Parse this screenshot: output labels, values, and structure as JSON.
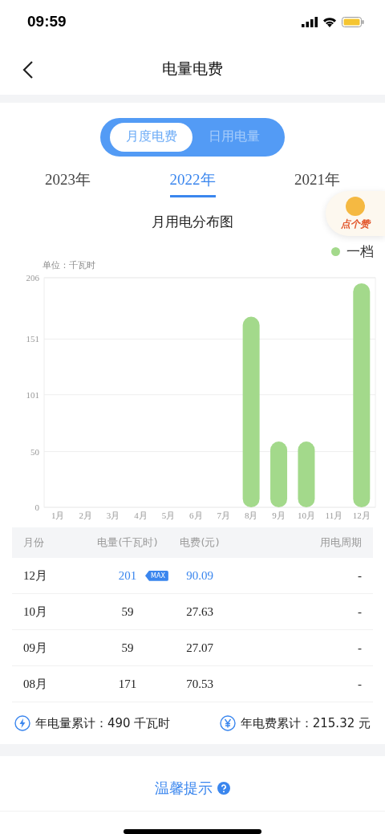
{
  "status_bar": {
    "time": "09:59"
  },
  "nav": {
    "title": "电量电费"
  },
  "mode_tabs": [
    {
      "label": "月度电费",
      "selected": true
    },
    {
      "label": "日用电量",
      "selected": false
    }
  ],
  "years": [
    {
      "label": "2023年",
      "selected": false
    },
    {
      "label": "2022年",
      "selected": true
    },
    {
      "label": "2021年",
      "selected": false
    }
  ],
  "like_badge": {
    "label": "点个赞"
  },
  "chart": {
    "title": "月用电分布图",
    "unit": "单位：千瓦时",
    "chart_data": {
      "type": "bar",
      "categories": [
        "1月",
        "2月",
        "3月",
        "4月",
        "5月",
        "6月",
        "7月",
        "8月",
        "9月",
        "10月",
        "11月",
        "12月"
      ],
      "series": [
        {
          "name": "一档",
          "color": "#a3d98b",
          "values": [
            null,
            null,
            null,
            null,
            null,
            null,
            null,
            171,
            59,
            59,
            null,
            201
          ]
        }
      ],
      "ylim": [
        0,
        206
      ],
      "yticks": [
        0,
        50,
        101,
        151,
        206
      ],
      "grid": true
    }
  },
  "table": {
    "columns": [
      "月份",
      "电量(千瓦时)",
      "电费(元)",
      "用电周期"
    ],
    "max_label": "MAX",
    "rows": [
      {
        "month": "12月",
        "kwh": "201",
        "fee": "90.09",
        "period": "-",
        "max": true
      },
      {
        "month": "10月",
        "kwh": "59",
        "fee": "27.63",
        "period": "-",
        "max": false
      },
      {
        "month": "09月",
        "kwh": "59",
        "fee": "27.07",
        "period": "-",
        "max": false
      },
      {
        "month": "08月",
        "kwh": "171",
        "fee": "70.53",
        "period": "-",
        "max": false
      }
    ]
  },
  "totals": [
    {
      "kind": "energy",
      "label": "年电量累计：490 千瓦时"
    },
    {
      "kind": "money",
      "label": "年电费累计：215.32 元"
    }
  ],
  "tip": {
    "label": "温馨提示"
  }
}
